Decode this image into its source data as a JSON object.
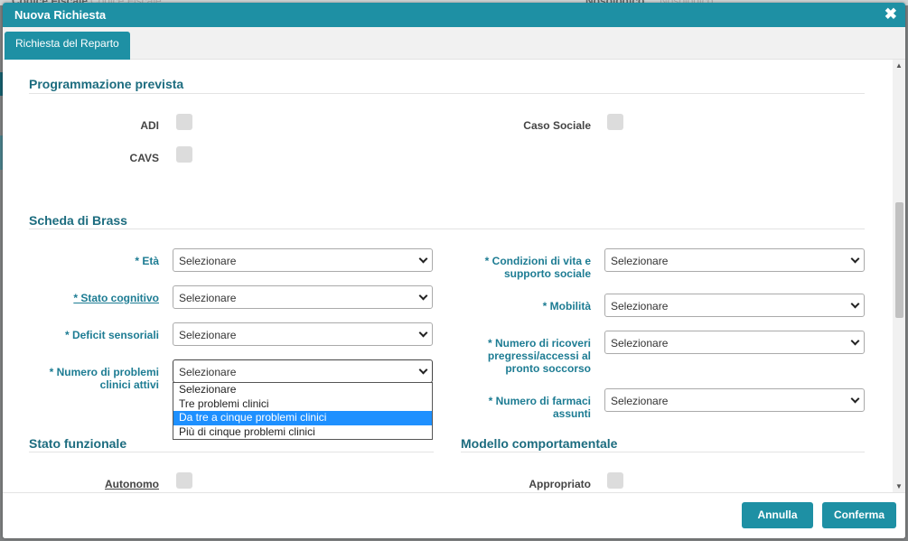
{
  "background": {
    "left_label": "Codice Fiscale",
    "left_placeholder": "Codice Fiscale",
    "right_label": "Nosologico",
    "right_placeholder": "Nosologico"
  },
  "modal": {
    "title": "Nuova Richiesta",
    "close_icon": "close-icon"
  },
  "tabs": [
    {
      "label": "Richiesta del Reparto"
    }
  ],
  "programmazione": {
    "title": "Programmazione prevista",
    "adi_label": "ADI",
    "cavs_label": "CAVS",
    "caso_sociale_label": "Caso Sociale"
  },
  "brass": {
    "title": "Scheda di Brass",
    "eta_label": "* Età",
    "eta_value": "Selezionare",
    "stato_cognitivo_label": "* Stato cognitivo",
    "stato_cognitivo_value": "Selezionare",
    "deficit_label": "* Deficit sensoriali",
    "deficit_value": "Selezionare",
    "problemi_label_1": "* Numero di problemi",
    "problemi_label_2": "clinici attivi",
    "problemi_value": "Selezionare",
    "problemi_options": [
      "Selezionare",
      "Tre problemi clinici",
      "Da tre a cinque problemi clinici",
      "Più di cinque problemi clinici"
    ],
    "problemi_highlighted": "Da tre a cinque problemi clinici",
    "condizioni_label_1": "* Condizioni di vita e",
    "condizioni_label_2": "supporto sociale",
    "condizioni_value": "Selezionare",
    "mobilita_label": "* Mobilità",
    "mobilita_value": "Selezionare",
    "ricoveri_label_1": "* Numero di ricoveri",
    "ricoveri_label_2": "pregressi/accessi al",
    "ricoveri_label_3": "pronto soccorso",
    "ricoveri_value": "Selezionare",
    "farmaci_label_1": "* Numero di farmaci",
    "farmaci_label_2": "assunti",
    "farmaci_value": "Selezionare"
  },
  "stato_funzionale": {
    "title": "Stato funzionale",
    "autonomo_label": "Autonomo"
  },
  "modello_comportamentale": {
    "title": "Modello comportamentale",
    "appropriato_label": "Appropriato"
  },
  "footer": {
    "cancel_label": "Annulla",
    "confirm_label": "Conferma"
  },
  "colors": {
    "accent": "#1e90a4",
    "label_teal": "#1d7c93",
    "section_title": "#1c6c7f",
    "highlight": "#1e90ff"
  }
}
